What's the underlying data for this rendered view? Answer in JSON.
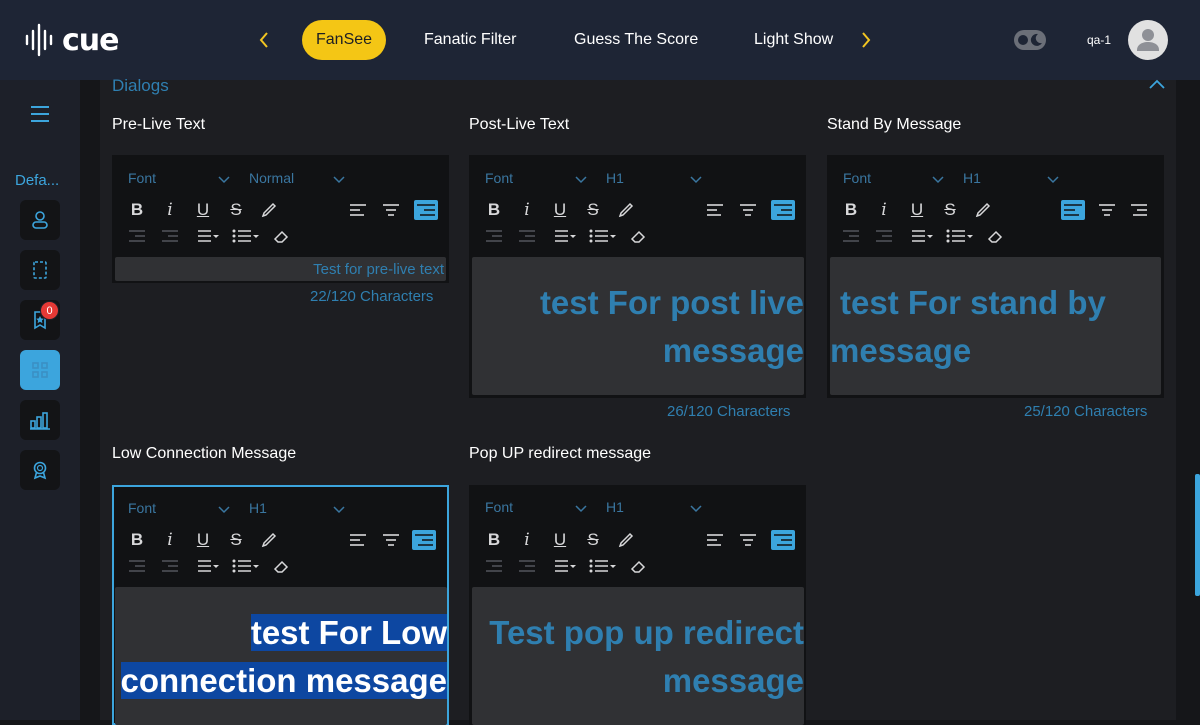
{
  "app": {
    "logo_text": "cue",
    "nav_tabs": [
      "FanSee",
      "Fanatic Filter",
      "Guess The Score",
      "Light Show"
    ],
    "active_tab": "FanSee",
    "user": "qa-1"
  },
  "sidebar": {
    "label": "Defa...",
    "notification_count": "0"
  },
  "section": {
    "title": "Dialogs"
  },
  "toolbar": {
    "font_label": "Font"
  },
  "editors": [
    {
      "label": "Pre-Live Text",
      "style": "Normal",
      "text": "Test for pre-live text",
      "count": "22/120 Characters",
      "align": "right"
    },
    {
      "label": "Post-Live Text",
      "style": "H1",
      "text_lines": [
        "test For post live",
        "message"
      ],
      "count": "26/120 Characters",
      "align": "right"
    },
    {
      "label": "Stand By Message",
      "style": "H1",
      "text_lines": [
        "test For stand by",
        "message"
      ],
      "count": "25/120 Characters",
      "align": "left"
    },
    {
      "label": "Low Connection Message",
      "style": "H1",
      "text_lines": [
        "test For Low",
        "connection message"
      ],
      "align": "right"
    },
    {
      "label": "Pop UP redirect message",
      "style": "H1",
      "text_lines": [
        "Test pop up redirect",
        "message"
      ],
      "align": "right"
    }
  ],
  "colors": {
    "accent": "#3ca5dd",
    "brand_yellow": "#f4c615",
    "topbar": "#1e2535"
  }
}
